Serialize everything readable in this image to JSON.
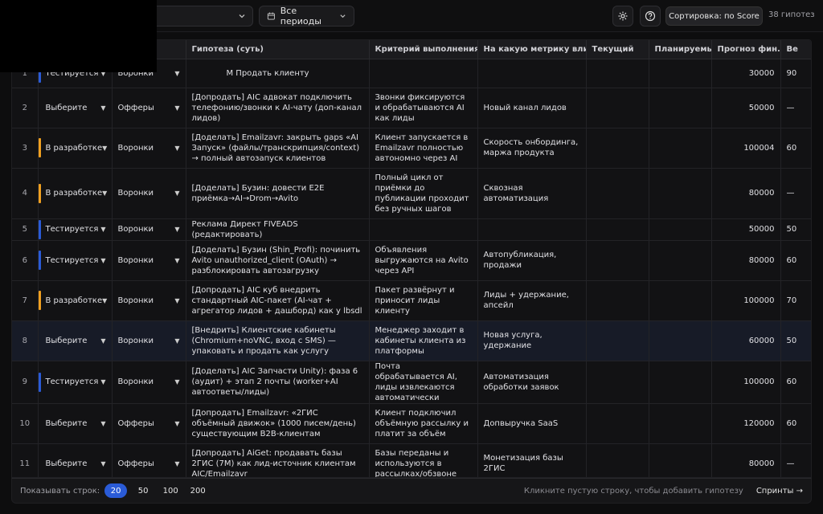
{
  "toolbar": {
    "period_label": "Все периоды",
    "sort_label": "Сортировка: по Score",
    "count_label": "38 гипотез"
  },
  "columns": [
    "",
    "",
    "Гипотеза (суть)",
    "Критерий выполнения",
    "На какую метрику влия",
    "Текущий",
    "Планируемы",
    "Прогноз фин. резу",
    "Ве"
  ],
  "rows": [
    {
      "num": "1",
      "status": "Тестируется",
      "stripe": "blue",
      "cat": "Воронки",
      "hyp": "М Продать клиенту",
      "crit": "",
      "metric": "",
      "forecast": "30000",
      "v": "90",
      "highlight": false
    },
    {
      "num": "2",
      "status": "Выберите",
      "stripe": "",
      "cat": "Офферы",
      "hyp": "[Допродать] AIC адвокат подключить телефонию/звонки к AI-чату (доп-канал лидов)",
      "crit": "Звонки фиксируются и обрабатываются AI как лиды",
      "metric": "Новый канал лидов",
      "forecast": "50000",
      "v": "—",
      "highlight": false
    },
    {
      "num": "3",
      "status": "В разработке",
      "stripe": "orange",
      "cat": "Воронки",
      "hyp": "[Доделать] Emailzavr: закрыть gaps «AI Запуск» (файлы/транскрипция/context) → полный автозапуск клиентов",
      "crit": "Клиент запускается в Emailzavr полностью автономно через AI",
      "metric": "Скорость онбординга, маржа продукта",
      "forecast": "100004",
      "v": "60",
      "highlight": false
    },
    {
      "num": "4",
      "status": "В разработке",
      "stripe": "orange",
      "cat": "Воронки",
      "hyp": "[Доделать] Бузин: довести E2E приёмка→AI→Drom→Avito",
      "crit": "Полный цикл от приёмки до публикации проходит без ручных шагов",
      "metric": "Сквозная автоматизация",
      "forecast": "80000",
      "v": "—",
      "highlight": false
    },
    {
      "num": "5",
      "status": "Тестируется",
      "stripe": "blue",
      "cat": "Воронки",
      "hyp": "Реклама Директ FIVEADS (редактировать)",
      "crit": "",
      "metric": "",
      "forecast": "50000",
      "v": "50",
      "highlight": false
    },
    {
      "num": "6",
      "status": "Тестируется",
      "stripe": "blue",
      "cat": "Воронки",
      "hyp": "[Доделать] Бузин (Shin_Profi): починить Avito unauthorized_client (OAuth) → разблокировать автозагрузку",
      "crit": "Объявления выгружаются на Avito через API",
      "metric": "Автопубликация, продажи",
      "forecast": "80000",
      "v": "60",
      "highlight": false
    },
    {
      "num": "7",
      "status": "В разработке",
      "stripe": "orange",
      "cat": "Воронки",
      "hyp": "[Допродать] AIC куб внедрить стандартный AIC-пакет (AI-чат + агрегатор лидов + дашборд) как у lbsdl",
      "crit": "Пакет развёрнут и приносит лиды клиенту",
      "metric": "Лиды + удержание, апсейл",
      "forecast": "100000",
      "v": "70",
      "highlight": false
    },
    {
      "num": "8",
      "status": "Выберите",
      "stripe": "",
      "cat": "Воронки",
      "hyp": "[Внедрить] Клиентские кабинеты (Chromium+noVNC, вход с SMS) — упаковать и продать как услугу",
      "crit": "Менеджер заходит в кабинеты клиента из платформы",
      "metric": "Новая услуга, удержание",
      "forecast": "60000",
      "v": "50",
      "highlight": true
    },
    {
      "num": "9",
      "status": "Тестируется",
      "stripe": "blue",
      "cat": "Воронки",
      "hyp": "[Доделать] AIC Запчасти Unity): фаза 6 (аудит) + этап 2 почты (worker+AI автоответы/лиды)",
      "crit": "Почта обрабатывается AI, лиды извлекаются автоматически",
      "metric": "Автоматизация обработки заявок",
      "forecast": "100000",
      "v": "60",
      "highlight": false
    },
    {
      "num": "10",
      "status": "Выберите",
      "stripe": "",
      "cat": "Офферы",
      "hyp": "[Допродать] Emailzavr: «2ГИС объёмный движок» (1000 писем/день) существующим B2B-клиентам",
      "crit": "Клиент подключил объёмную рассылку и платит за объём",
      "metric": "Допвыручка SaaS",
      "forecast": "120000",
      "v": "60",
      "highlight": false
    },
    {
      "num": "11",
      "status": "Выберите",
      "stripe": "",
      "cat": "Офферы",
      "hyp": "[Допродать] AiGet: продавать базы 2ГИС (7М) как лид-источник клиентам AIC/Emailzavr",
      "crit": "Базы переданы и используются в рассылках/обзвоне",
      "metric": "Монетизация базы 2ГИС",
      "forecast": "80000",
      "v": "—",
      "highlight": false
    }
  ],
  "footer": {
    "rows_label": "Показывать строк:",
    "sizes": [
      "20",
      "50",
      "100",
      "200"
    ],
    "hint": "Кликните пустую строку, чтобы добавить гипотезу",
    "sprint_link": "Спринты →"
  }
}
